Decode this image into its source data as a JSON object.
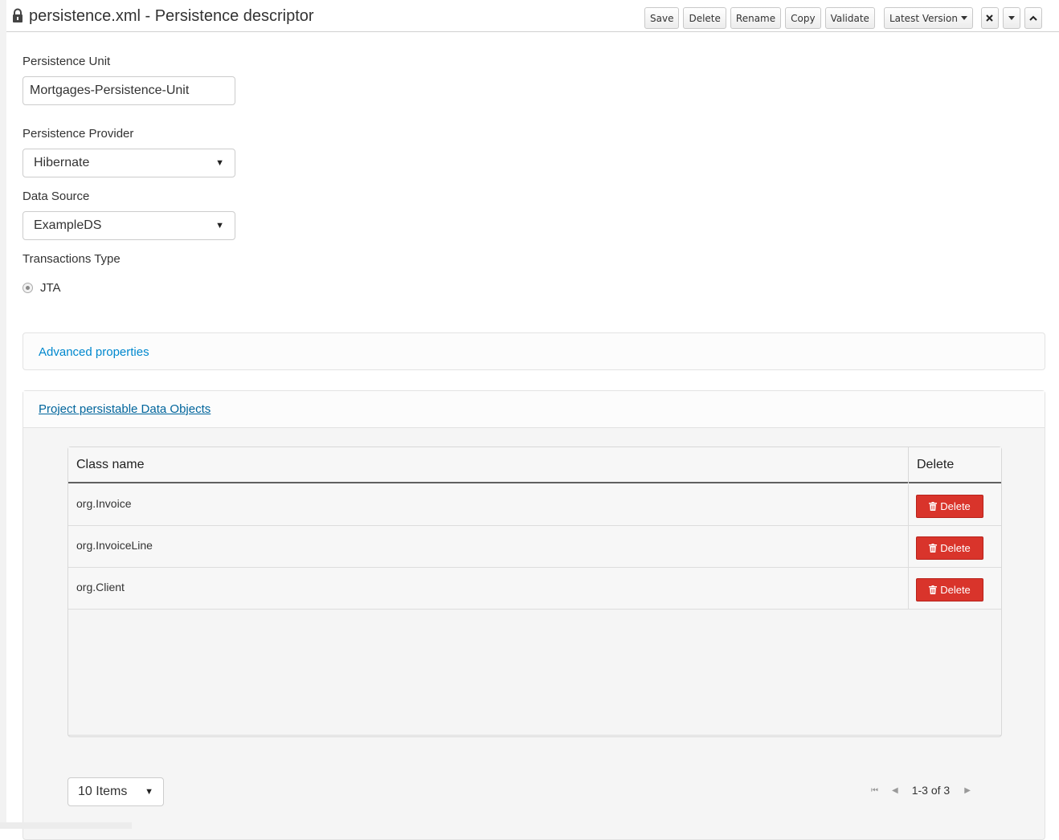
{
  "header": {
    "title": "persistence.xml - Persistence descriptor",
    "buttons": {
      "save": "Save",
      "delete": "Delete",
      "rename": "Rename",
      "copy": "Copy",
      "validate": "Validate",
      "latest_version": "Latest Version"
    }
  },
  "form": {
    "unit_label": "Persistence Unit",
    "unit_value": "Mortgages-Persistence-Unit",
    "provider_label": "Persistence Provider",
    "provider_value": "Hibernate",
    "datasource_label": "Data Source",
    "datasource_value": "ExampleDS",
    "transactions_label": "Transactions Type",
    "transactions_option": "JTA"
  },
  "advanced": {
    "title": "Advanced properties"
  },
  "data_objects": {
    "title": "Project persistable Data Objects",
    "columns": {
      "class_name": "Class name",
      "delete": "Delete"
    },
    "rows": [
      {
        "class_name": "org.Invoice",
        "action": "Delete"
      },
      {
        "class_name": "org.InvoiceLine",
        "action": "Delete"
      },
      {
        "class_name": "org.Client",
        "action": "Delete"
      }
    ],
    "page_size": "10 Items",
    "range": "1-3 of 3"
  },
  "colors": {
    "danger": "#d9342b",
    "link": "#0088ce",
    "link_dark": "#00659c"
  }
}
